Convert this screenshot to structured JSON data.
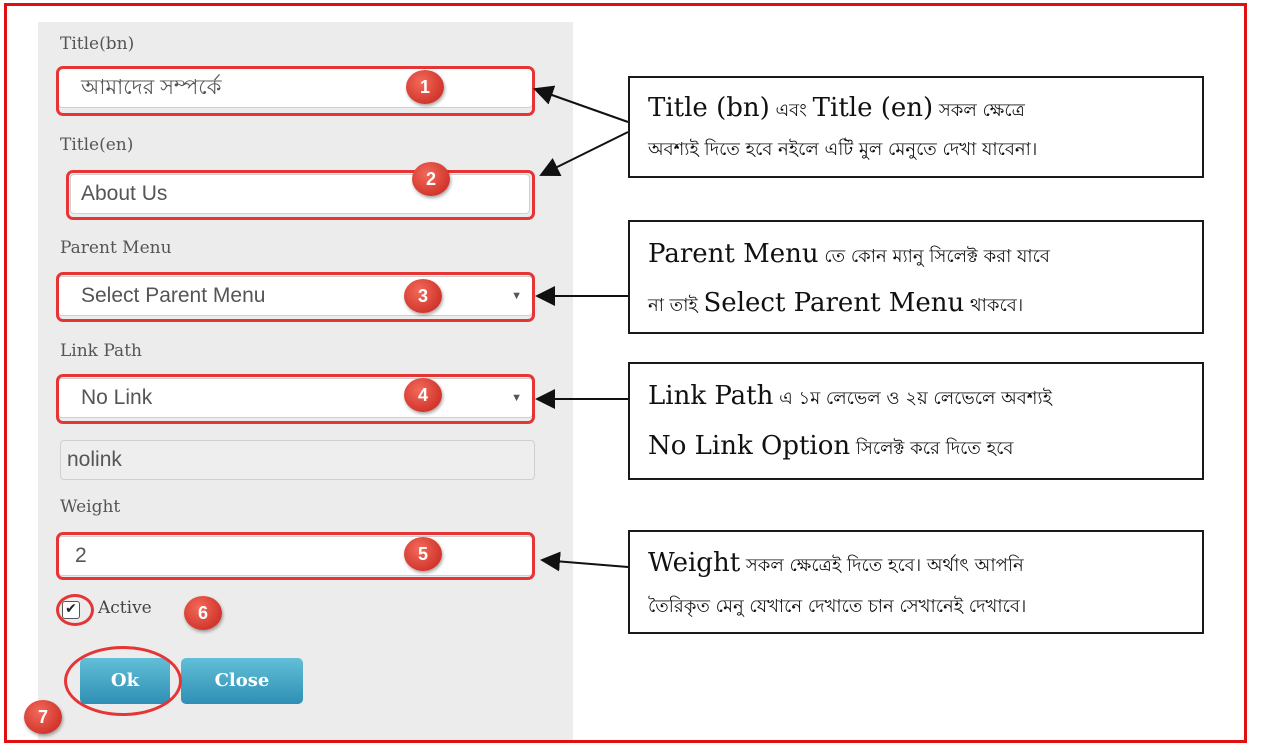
{
  "form": {
    "title_bn_label": "Title(bn)",
    "title_bn_value": "আমাদের সম্পর্কে",
    "title_en_label": "Title(en)",
    "title_en_value": "About Us",
    "parent_menu_label": "Parent Menu",
    "parent_menu_selected": "Select Parent Menu",
    "link_path_label": "Link Path",
    "link_path_selected": "No Link",
    "link_path_value": "nolink",
    "weight_label": "Weight",
    "weight_value": "2",
    "active_label": "Active",
    "active_checked": true,
    "ok_label": "Ok",
    "close_label": "Close"
  },
  "badges": [
    "1",
    "2",
    "3",
    "4",
    "5",
    "6",
    "7"
  ],
  "notes": {
    "n1": {
      "a": "Title (bn)",
      "b": " এবং ",
      "c": "Title (en)",
      "d": " সকল ক্ষেত্রে",
      "line2": "অবশ্যই দিতে হবে নইলে এটি মুল মেনুতে দেখা যাবেনা।"
    },
    "n2": {
      "a": "Parent Menu",
      "b": " তে কোন ম্যানু সিলেক্ট করা যাবে",
      "c": "না তাই ",
      "d": "Select Parent Menu",
      "e": " থাকবে।"
    },
    "n3": {
      "a": "Link Path",
      "b": " এ ১ম লেভেল ও ২য় লেভেলে অবশ্যই",
      "c": "No Link Option",
      "d": " সিলেক্ট করে দিতে হবে"
    },
    "n4": {
      "a": "Weight",
      "b": " সকল ক্ষেত্রেই দিতে হবে। অর্থাৎ আপনি",
      "line2": "তৈরিকৃত মেনু যেখানে দেখাতে চান সেখানেই দেখাবে।"
    }
  },
  "colors": {
    "frame": "#e01010",
    "highlight": "#e53535",
    "badge": "#d43a2c",
    "button": "#3a9cc2",
    "panel": "#ececec"
  }
}
